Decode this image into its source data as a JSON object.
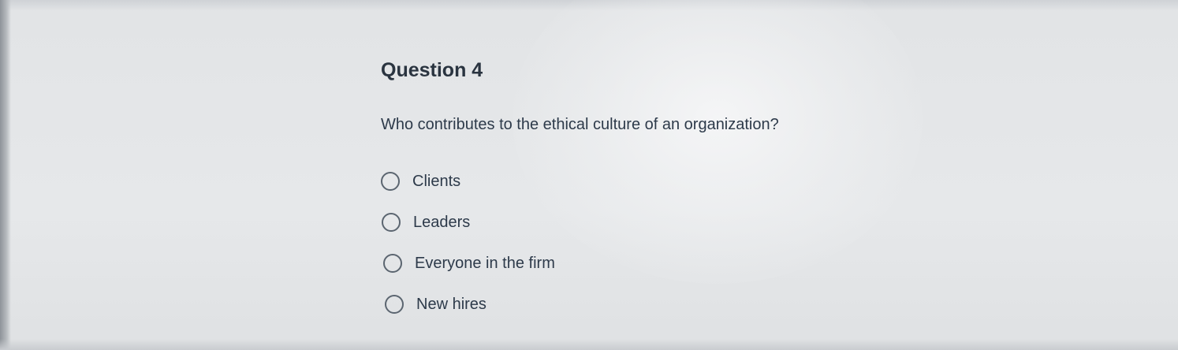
{
  "question": {
    "title": "Question 4",
    "prompt": "Who contributes to the ethical culture of an organization?",
    "options": [
      {
        "label": "Clients",
        "selected": false
      },
      {
        "label": "Leaders",
        "selected": false
      },
      {
        "label": "Everyone in the firm",
        "selected": false
      },
      {
        "label": "New hires",
        "selected": false
      }
    ]
  },
  "colors": {
    "text": "#2d3a4a",
    "background": "#e4e6e8"
  }
}
